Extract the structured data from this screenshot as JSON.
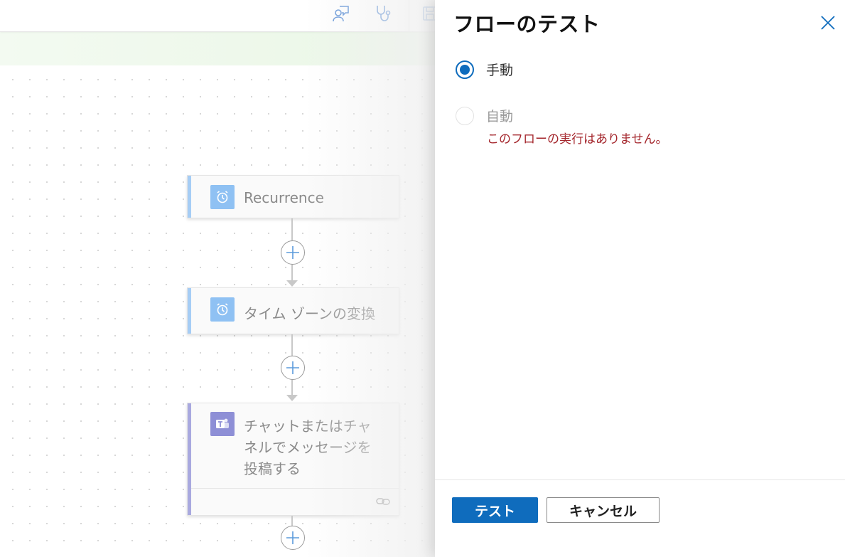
{
  "panel": {
    "title": "フローのテスト",
    "options": [
      {
        "label": "手動",
        "selected": true,
        "enabled": true
      },
      {
        "label": "自動",
        "selected": false,
        "enabled": false
      }
    ],
    "no_runs_message": "このフローの実行はありません。",
    "test_button": "テスト",
    "cancel_button": "キャンセル"
  },
  "flow": {
    "steps": [
      {
        "title": "Recurrence",
        "icon": "alarm-clock-icon"
      },
      {
        "title": "タイム ゾーンの変換",
        "icon": "alarm-clock-icon"
      },
      {
        "title_lines": [
          "チャットまたはチャ",
          "ネルでメッセージを",
          "投稿する"
        ],
        "icon": "teams-icon"
      }
    ]
  },
  "toolbar": {
    "icons": [
      "feedback-icon",
      "stethoscope-icon",
      "save-icon"
    ]
  },
  "colors": {
    "accent_blue": "#0f6cbd",
    "recurrence_accent": "#a6cdf5",
    "recurrence_icon_bg": "#8fc1f3",
    "teams_accent": "#a9a9df",
    "teams_icon_bg": "#8e8fd6",
    "error_red": "#a4262c"
  }
}
